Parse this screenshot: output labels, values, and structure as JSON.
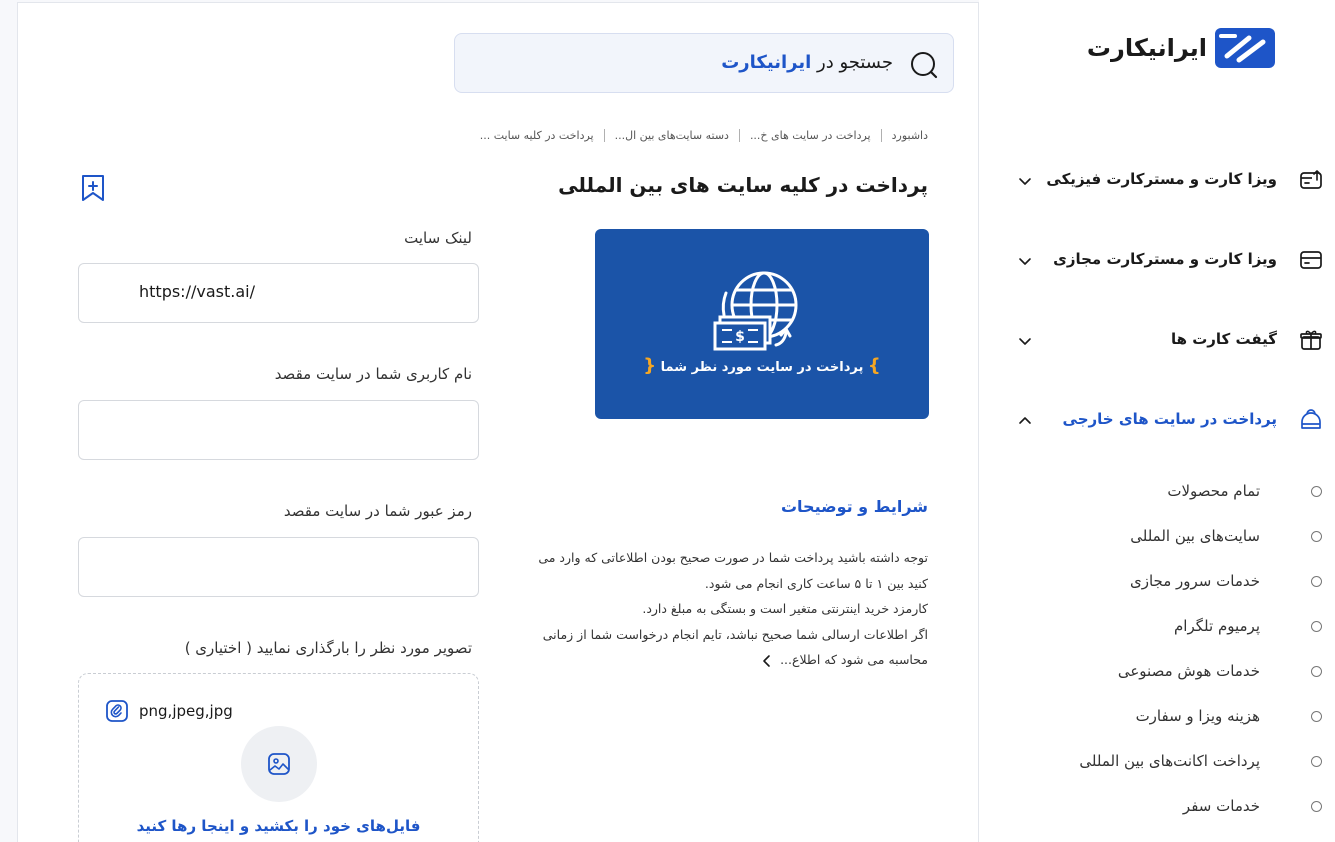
{
  "search": {
    "prefix": "جستجو در",
    "brand": "ایرانیکارت",
    "icon": "search-icon"
  },
  "breadcrumb": [
    "داشبورد",
    "پرداخت در سایت های خ...",
    "دسته سایت‌های بین ال...",
    "پرداخت در کلیه سایت ..."
  ],
  "page": {
    "title": "پرداخت در کلیه سایت های بین المللی",
    "bookmark_icon": "bookmark-add-icon"
  },
  "banner": {
    "text": "پرداخت در سایت مورد نظر شما",
    "brace_open": "{",
    "brace_close": "}",
    "icon": "globe-payment-icon"
  },
  "terms": {
    "title": "شرایط و توضیحات",
    "lines": [
      "توجه داشته باشید پرداخت شما در صورت صحیح بودن اطلاعاتی که وارد می",
      "کنید بین ۱ تا ۵ ساعت کاری انجام می شود.",
      "کارمزد خرید اینترنتی متغیر است و بستگی به مبلغ دارد.",
      "اگر اطلاعات ارسالی شما صحیح نباشد، تایم انجام درخواست شما از زمانی",
      "محاسبه می شود که اطلاع..."
    ]
  },
  "form": {
    "site_link": {
      "label": "لینک سایت",
      "value": "https://vast.ai/"
    },
    "username": {
      "label": "نام کاربری شما در سایت مقصد",
      "value": ""
    },
    "password": {
      "label": "رمز عبور شما در سایت مقصد",
      "value": ""
    },
    "upload": {
      "label": "تصویر مورد نظر را بارگذاری نمایید ( اختیاری )",
      "formats": "png,jpeg,jpg",
      "drop_text": "فایل‌های خود را بکشید و اینجا رها کنید"
    }
  },
  "sidebar": {
    "logo_text": "ایرانیکارت",
    "items": [
      {
        "label": "ویزا کارت و مسترکارت فیزیکی",
        "icon": "card-export-icon",
        "expanded": false
      },
      {
        "label": "ویزا کارت و مسترکارت مجازی",
        "icon": "credit-card-icon",
        "expanded": false
      },
      {
        "label": "گیفت کارت ها",
        "icon": "gift-icon",
        "expanded": false
      },
      {
        "label": "پرداخت در سایت های خارجی",
        "icon": "bag-icon",
        "expanded": true
      }
    ],
    "subitems": [
      "تمام محصولات",
      "سایت‌های بین المللی",
      "خدمات سرور مجازی",
      "پرمیوم تلگرام",
      "خدمات هوش مصنوعی",
      "هزینه ویزا و سفارت",
      "پرداخت اکانت‌های بین المللی",
      "خدمات سفر"
    ]
  },
  "colors": {
    "accent": "#1e55c8",
    "banner": "#1b54a8",
    "brace": "#f5a623"
  }
}
